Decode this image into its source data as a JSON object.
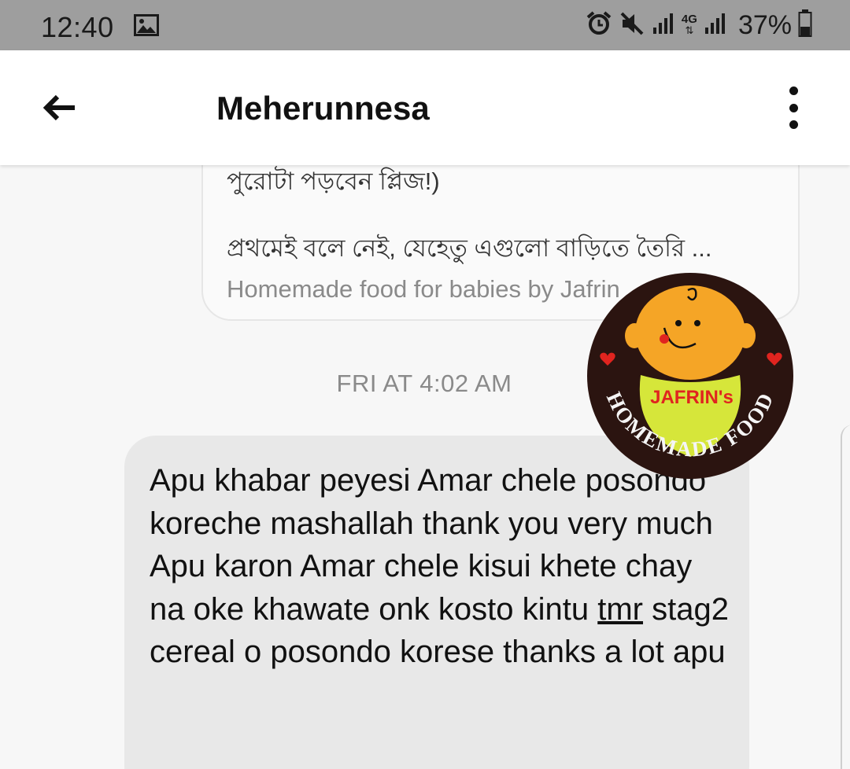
{
  "status_bar": {
    "time": "12:40",
    "network_label": "4G",
    "battery": "37%",
    "icons": [
      "image-icon",
      "alarm-icon",
      "mute-icon",
      "signal-icon",
      "4g-icon",
      "signal-icon",
      "battery-icon"
    ]
  },
  "header": {
    "title": "Meherunnesa",
    "back_icon": "back-arrow-icon",
    "menu_icon": "more-vert-icon"
  },
  "link_card": {
    "cut_line": "পুরোটা পড়বেন প্লিজ!)",
    "line": "প্রথমেই বলে নেই, যেহেতু এগুলো বাড়িতে তৈরি ...",
    "source": "Homemade food for babies by Jafrin"
  },
  "timestamp": "FRI AT 4:02 AM",
  "message": {
    "before": "Apu khabar peyesi Amar chele posondo koreche mashallah thank you very much Apu karon Amar chele kisui khete chay na oke khawate onk kosto kintu ",
    "underlined": "tmr",
    "after": " stag2 cereal o posondo korese thanks a lot apu"
  },
  "logo": {
    "brand": "JAFRIN's",
    "arc_text": "HOMEMADE FOOD",
    "colors": {
      "ring": "#2b1410",
      "face": "#f5a526",
      "bib": "#d6e63a",
      "brand_text": "#e0241f",
      "heart": "#e0241f"
    }
  },
  "colors": {
    "status_bar": "#9e9e9e",
    "bubble": "#e8e8e8",
    "background": "#f7f7f7"
  }
}
